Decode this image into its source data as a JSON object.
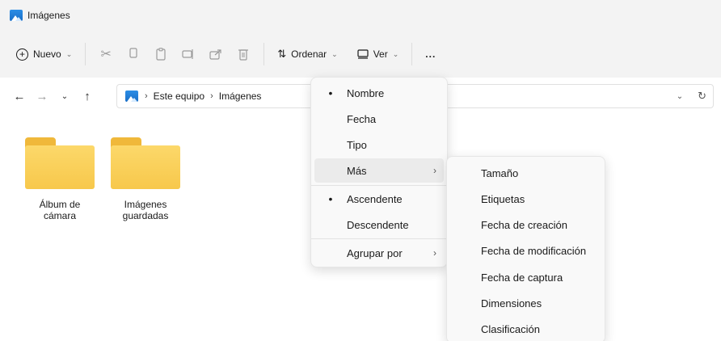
{
  "window": {
    "title": "Imágenes"
  },
  "toolbar": {
    "new_label": "Nuevo",
    "sort_label": "Ordenar",
    "view_label": "Ver",
    "more_label": "..."
  },
  "address": {
    "crumbs": [
      "Este equipo",
      "Imágenes"
    ]
  },
  "folders": [
    {
      "line1": "Álbum de",
      "line2": "cámara"
    },
    {
      "line1": "Imágenes",
      "line2": "guardadas"
    }
  ],
  "sort_menu": {
    "items": [
      {
        "label": "Nombre",
        "checked": true
      },
      {
        "label": "Fecha",
        "checked": false
      },
      {
        "label": "Tipo",
        "checked": false
      },
      {
        "label": "Más",
        "checked": false,
        "submenu": true
      },
      {
        "label": "Ascendente",
        "checked": true
      },
      {
        "label": "Descendente",
        "checked": false
      },
      {
        "label": "Agrupar por",
        "checked": false,
        "submenu": true
      }
    ]
  },
  "more_submenu": {
    "items": [
      "Tamaño",
      "Etiquetas",
      "Fecha de creación",
      "Fecha de modificación",
      "Fecha de captura",
      "Dimensiones",
      "Clasificación"
    ]
  }
}
